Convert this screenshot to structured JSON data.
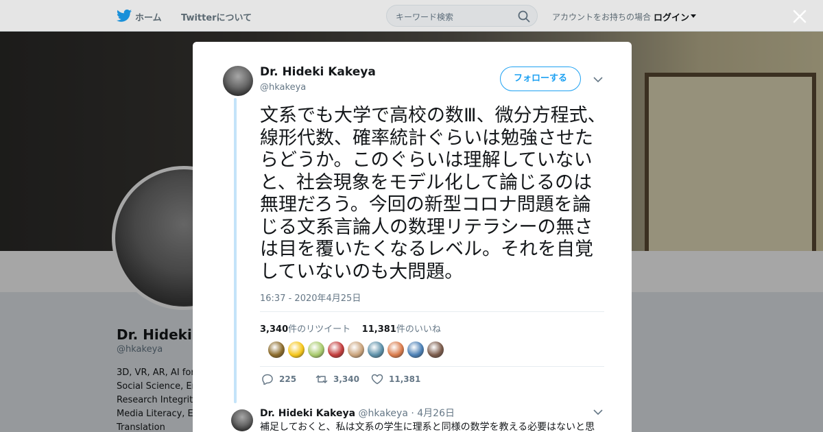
{
  "nav": {
    "home_label": "ホーム",
    "about_label": "Twitterについて",
    "search_placeholder": "キーワード検索",
    "login_prompt": "アカウントをお持ちの場合",
    "login_label": "ログイン"
  },
  "background_profile": {
    "name": "Dr. Hideki K",
    "handle": "@hkakeya",
    "bio_lines": [
      "3D, VR, AR, AI for",
      "Social Science, En",
      "Research Integrity",
      "Media Literacy, En",
      "Translation"
    ]
  },
  "tweet": {
    "author_name": "Dr. Hideki Kakeya",
    "author_handle": "@hkakeya",
    "follow_label": "フォローする",
    "text": "文系でも大学で高校の数Ⅲ、微分方程式、線形代数、確率統計ぐらいは勉強させたらどうか。このぐらいは理解していないと、社会現象をモデル化して論じるのは無理だろう。今回の新型コロナ問題を論じる文系言論人の数理リテラシーの無さは目を覆いたくなるレベル。それを自覚していないのも大問題。",
    "timestamp": "16:37 - 2020年4月25日",
    "retweet_count": "3,340",
    "retweet_suffix": "件のリツイート",
    "like_count": "11,381",
    "like_suffix": "件のいいね",
    "actions": {
      "reply_count": "225",
      "retweet_count": "3,340",
      "like_count": "11,381"
    },
    "liker_colors": [
      "#8a6a2a",
      "#f5c518",
      "#a7c96b",
      "#c23b3b",
      "#c9a27a",
      "#5b8fa8",
      "#d97a4a",
      "#4a7fb5",
      "#7a5a4a"
    ]
  },
  "reply": {
    "author_name": "Dr. Hideki Kakeya",
    "author_handle": "@hkakeya",
    "separator": "·",
    "date": "4月26日",
    "text": "補足しておくと、私は文系の学生に理系と同様の数学を教える必要はないと思"
  },
  "colors": {
    "accent": "#1da1f2",
    "text": "#14171a",
    "muted": "#657786"
  }
}
